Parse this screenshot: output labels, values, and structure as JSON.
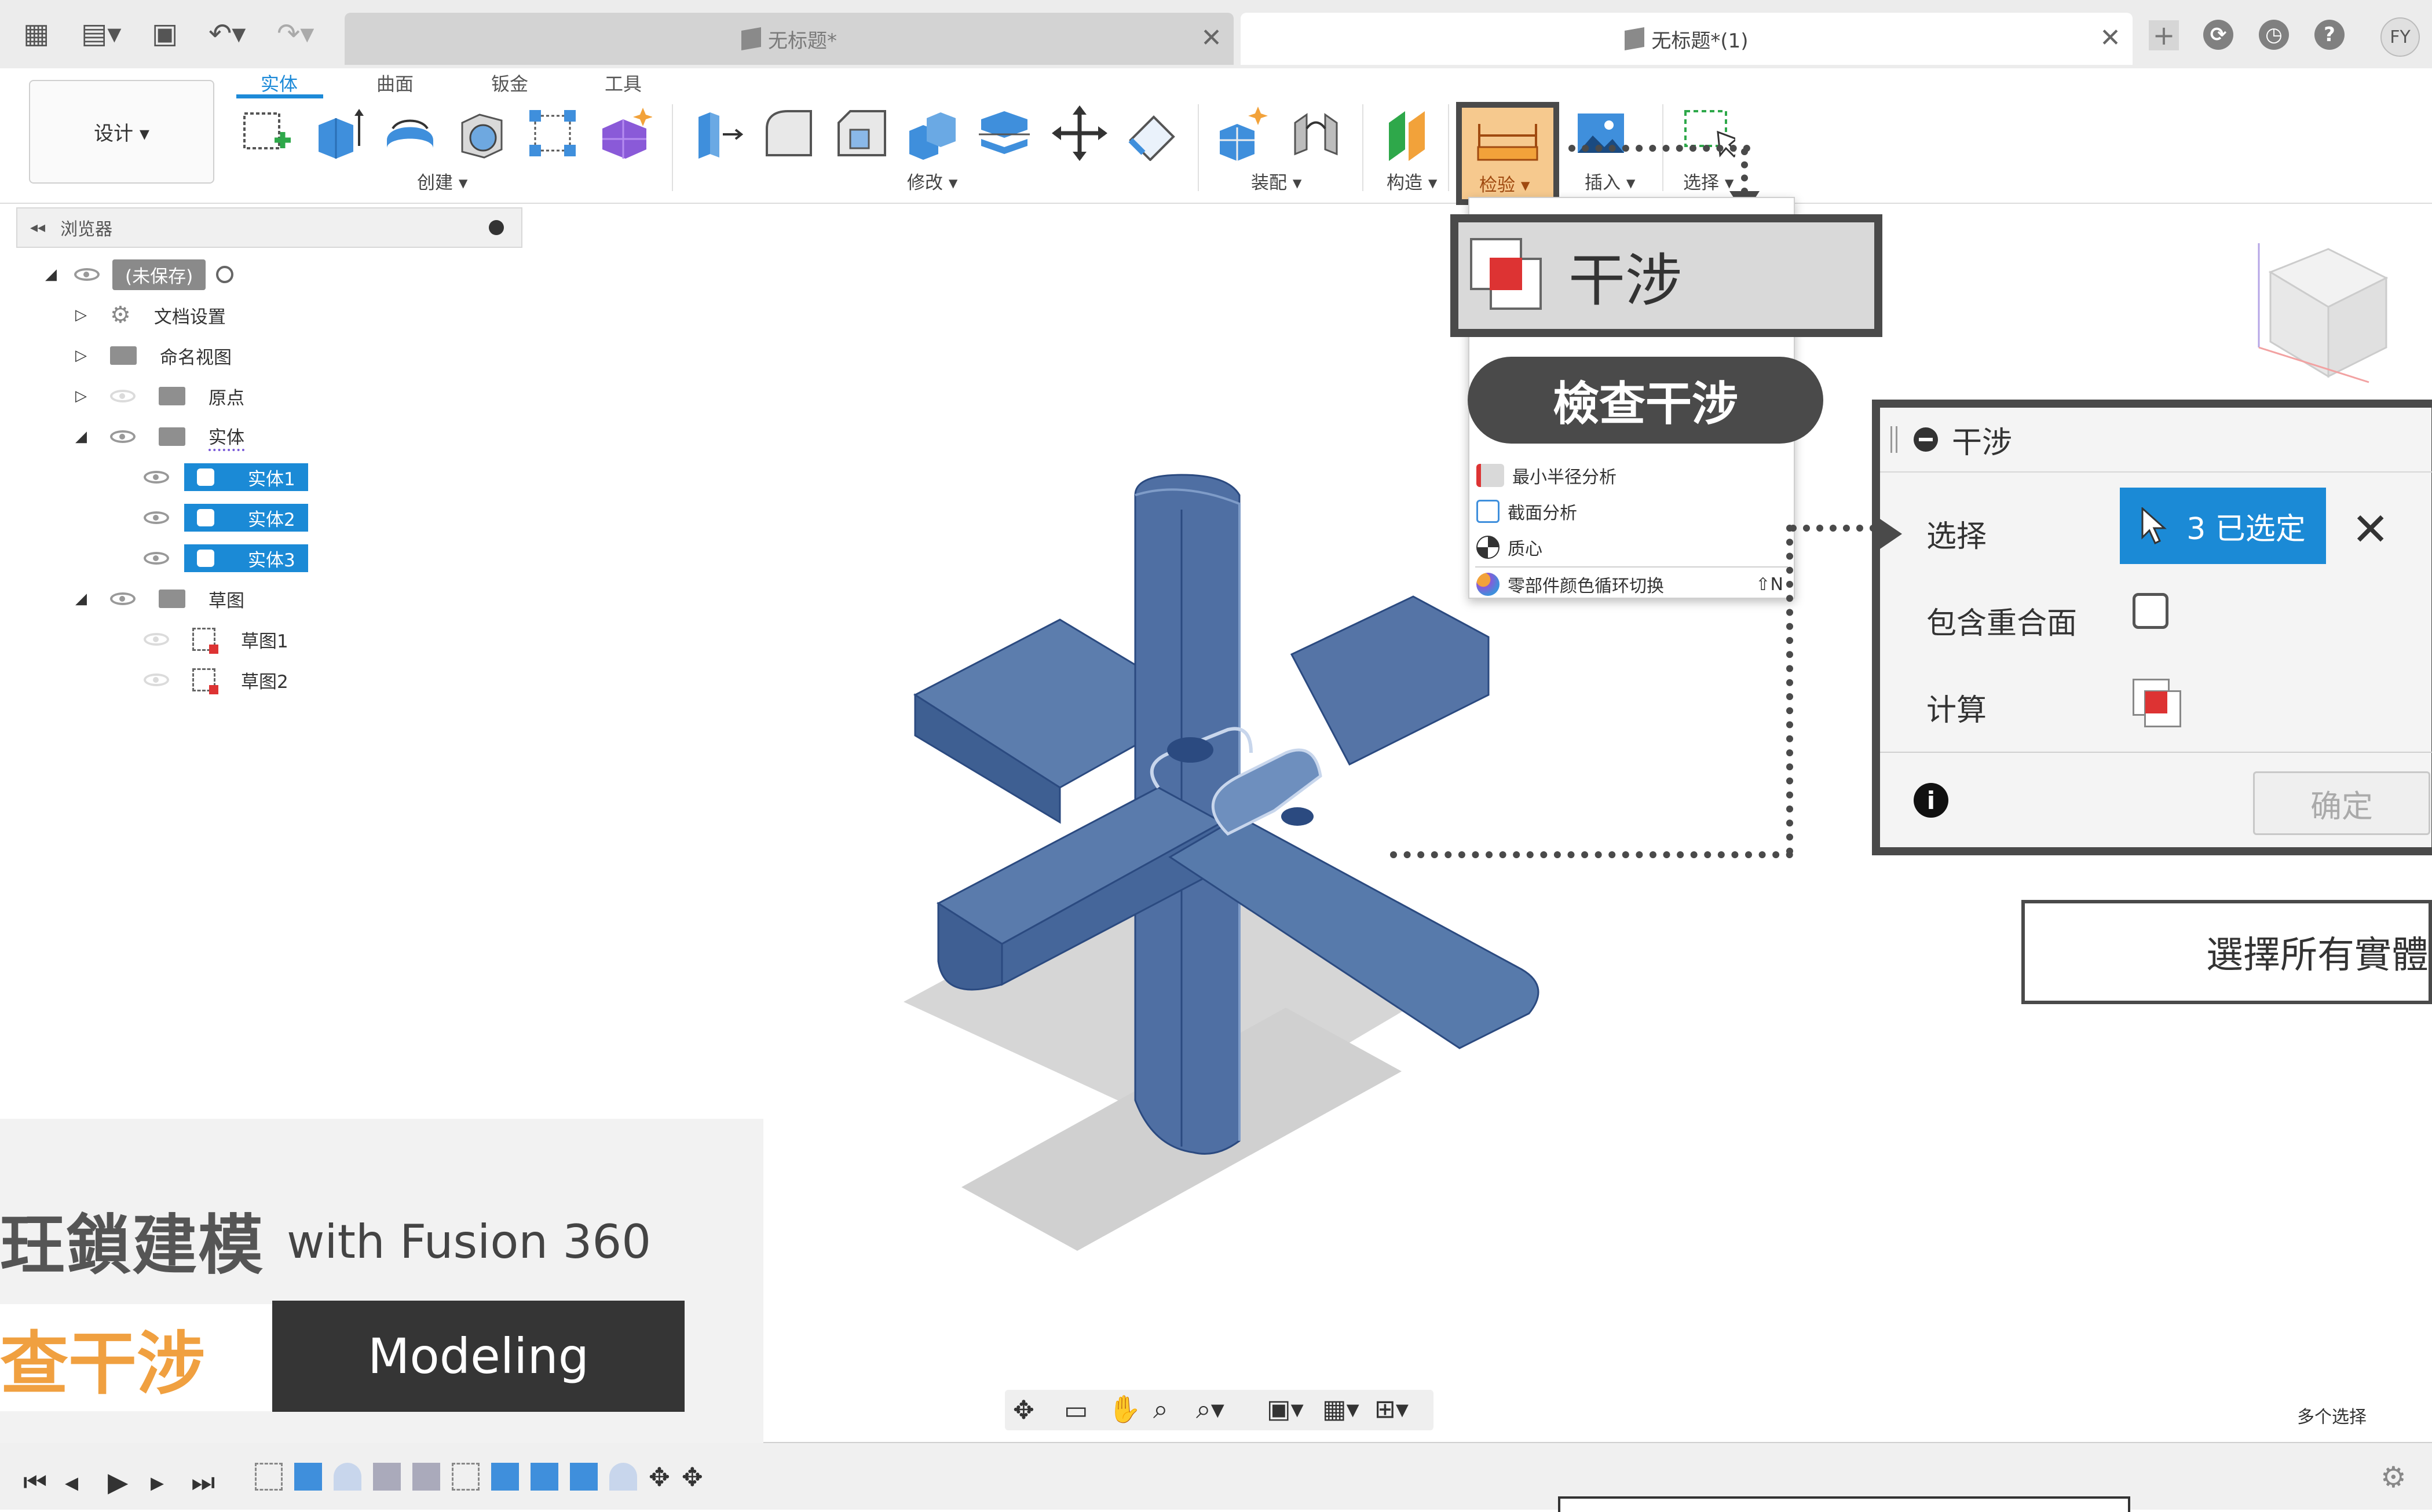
{
  "titlebar": {
    "tab1_title": "无标题*",
    "tab2_title": "无标题*(1)",
    "user_initials": "FY"
  },
  "toolbar": {
    "design_label": "设计 ▾",
    "tabs": [
      "实体",
      "曲面",
      "钣金",
      "工具"
    ],
    "groups": {
      "create": "创建 ▾",
      "modify": "修改 ▾",
      "assemble": "装配 ▾",
      "construct": "构造 ▾",
      "inspect": "检验 ▾",
      "insert": "插入 ▾",
      "select": "选择 ▾"
    }
  },
  "browser": {
    "title": "浏览器",
    "root": "(未保存)",
    "items": [
      {
        "label": "文档设置"
      },
      {
        "label": "命名视图"
      },
      {
        "label": "原点"
      },
      {
        "label": "实体"
      },
      {
        "label": "实体1"
      },
      {
        "label": "实体2"
      },
      {
        "label": "实体3"
      },
      {
        "label": "草图"
      },
      {
        "label": "草图1"
      },
      {
        "label": "草图2"
      }
    ]
  },
  "dropdown": {
    "callout_label": "干涉",
    "pill_label": "檢查干涉",
    "items": [
      "最小半径分析",
      "截面分析",
      "质心",
      "零部件颜色循环切换"
    ],
    "shortcut": "⇧N"
  },
  "dialog": {
    "title": "干涉",
    "select_label": "选择",
    "select_value": "3 已选定",
    "include_coincident_label": "包含重合面",
    "compute_label": "计算",
    "ok_label": "确定"
  },
  "annotation": {
    "select_all": "選擇所有實體"
  },
  "caption": {
    "title": "玨鎖建模",
    "subtitle": "with Fusion 360",
    "highlight": "查干涉",
    "badge": "Modeling"
  },
  "status": {
    "multi_select": "多个选择"
  },
  "colors": {
    "accent": "#1b8ad6",
    "model": "#4a6a9a",
    "inspect_highlight": "#f6c98e",
    "caption_orange": "#f0a040",
    "dark": "#4a4a4a"
  }
}
